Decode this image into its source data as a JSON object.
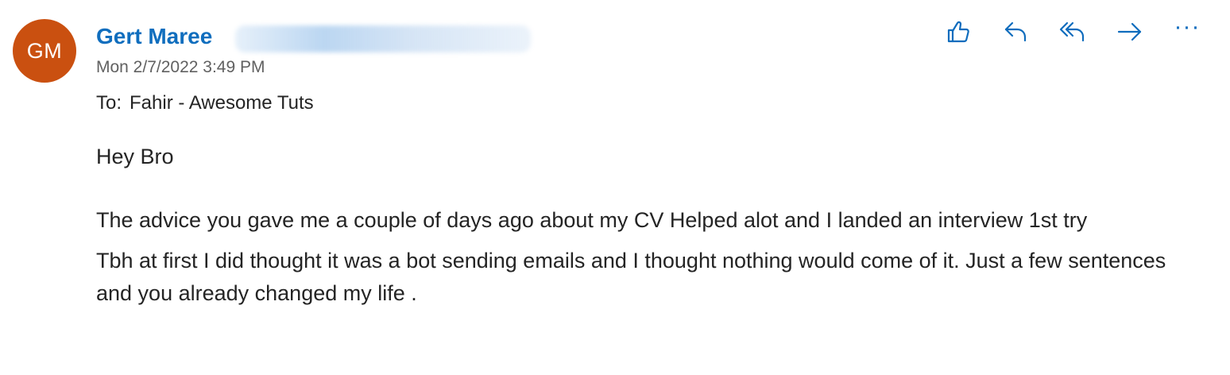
{
  "window": {
    "title": ""
  },
  "sender": {
    "initials": "GM",
    "avatar_color": "#ca5010",
    "name": "Gert Maree",
    "email_redacted": true,
    "name_color": "#106ebe"
  },
  "message": {
    "timestamp": "Mon 2/7/2022 3:49 PM",
    "to_label": "To:",
    "to_value": "Fahir - Awesome Tuts",
    "greeting": "Hey Bro",
    "paragraph_1": "The advice you gave me a couple of days ago about my CV Helped alot and I landed an interview 1st try",
    "paragraph_2": "Tbh at first I did thought it was a bot sending emails and I thought nothing would come of it.  Just a few sentences and you already changed my life ."
  },
  "toolbar": {
    "accent_color": "#0f6cbd",
    "actions": [
      {
        "icon": "like-icon"
      },
      {
        "icon": "reply-icon"
      },
      {
        "icon": "reply-all-icon"
      },
      {
        "icon": "forward-icon"
      },
      {
        "icon": "more-icon",
        "glyph": "···"
      }
    ]
  }
}
